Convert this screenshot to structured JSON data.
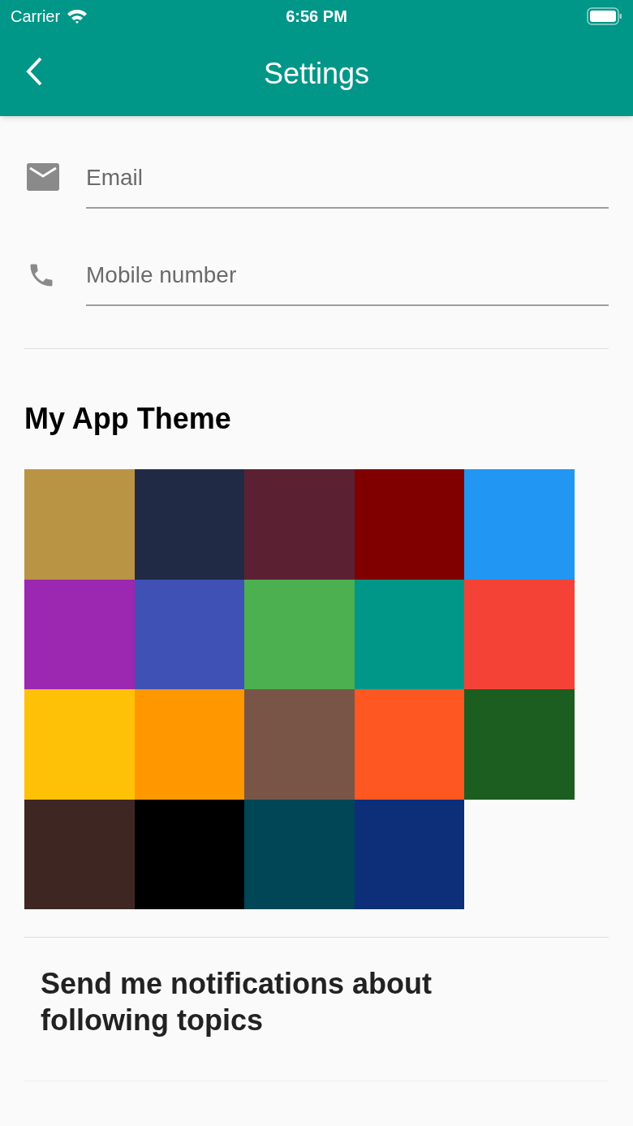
{
  "status_bar": {
    "carrier": "Carrier",
    "time": "6:56 PM"
  },
  "app_bar": {
    "title": "Settings"
  },
  "fields": [
    {
      "kind": "email",
      "placeholder": "Email"
    },
    {
      "kind": "phone",
      "placeholder": "Mobile number"
    }
  ],
  "theme": {
    "heading": "My App Theme",
    "swatches": [
      {
        "color": "#b99445"
      },
      {
        "color": "#202a44"
      },
      {
        "color": "#5b2133"
      },
      {
        "color": "#800000"
      },
      {
        "color": "#2196f3"
      },
      {
        "color": "#9c27b0"
      },
      {
        "color": "#3f51b5"
      },
      {
        "color": "#4caf50"
      },
      {
        "color": "#009688"
      },
      {
        "color": "#f44336"
      },
      {
        "color": "#ffc107"
      },
      {
        "color": "#ff9800"
      },
      {
        "color": "#795548"
      },
      {
        "color": "#ff5722"
      },
      {
        "color": "#1b5e20"
      },
      {
        "color": "#3e2723"
      },
      {
        "color": "#000000"
      },
      {
        "color": "#004656"
      },
      {
        "color": "#0d2e78"
      }
    ]
  },
  "notifications": {
    "heading": "Send me notifications about following topics"
  }
}
